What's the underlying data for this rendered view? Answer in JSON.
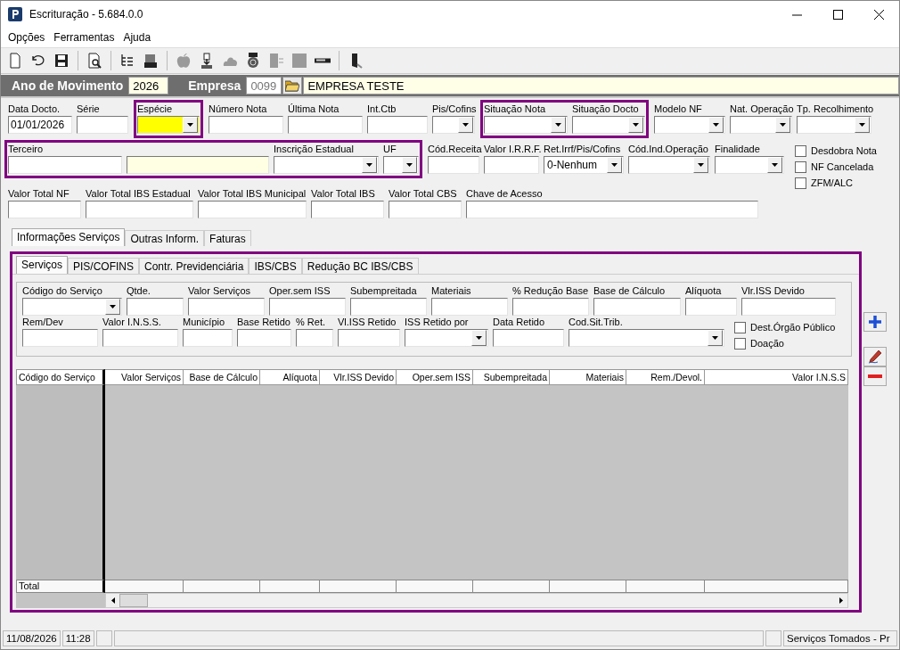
{
  "window": {
    "title": "Escrituração - 5.684.0.0"
  },
  "menu": [
    "Opções",
    "Ferramentas",
    "Ajuda"
  ],
  "toolbar": [
    {
      "kind": "new",
      "disabled": false
    },
    {
      "kind": "undo",
      "disabled": false
    },
    {
      "kind": "save",
      "disabled": false
    },
    {
      "kind": "separator"
    },
    {
      "kind": "preview",
      "disabled": false
    },
    {
      "kind": "separator"
    },
    {
      "kind": "tree",
      "disabled": false
    },
    {
      "kind": "machine",
      "disabled": false
    },
    {
      "kind": "separator"
    },
    {
      "kind": "apple",
      "disabled": true
    },
    {
      "kind": "download",
      "disabled": false
    },
    {
      "kind": "cloud",
      "disabled": true
    },
    {
      "kind": "coin",
      "disabled": false
    },
    {
      "kind": "panel",
      "disabled": true
    },
    {
      "kind": "block",
      "disabled": true
    },
    {
      "kind": "bar",
      "disabled": false
    },
    {
      "kind": "separator"
    },
    {
      "kind": "exit",
      "disabled": false
    }
  ],
  "header": {
    "year_label": "Ano de Movimento",
    "year": "2026",
    "company_label": "Empresa",
    "company_code": "0099",
    "company_name": "EMPRESA TESTE"
  },
  "form_rows": [
    [
      {
        "highlighted": false,
        "fields": [
          {
            "label": "Data Docto.",
            "kind": "text",
            "value": "01/01/2026"
          },
          {
            "label": "Série",
            "kind": "text"
          }
        ]
      },
      {
        "highlighted": true,
        "fields": [
          {
            "label": "Espécie",
            "kind": "combo",
            "focused": true
          }
        ]
      },
      {
        "highlighted": false,
        "fields": [
          {
            "label": "Número Nota",
            "kind": "text"
          },
          {
            "label": "Última Nota",
            "kind": "text"
          },
          {
            "label": "Int.Ctb",
            "kind": "text"
          },
          {
            "label": "Pis/Cofins",
            "kind": "combo"
          }
        ]
      },
      {
        "highlighted": true,
        "fields": [
          {
            "label": "Situação Nota",
            "kind": "combo"
          },
          {
            "label": "Situação Docto",
            "kind": "combo"
          }
        ]
      },
      {
        "highlighted": false,
        "fields": [
          {
            "label": "Modelo NF",
            "kind": "combo"
          },
          {
            "label": "Nat. Operação",
            "kind": "combo"
          },
          {
            "label": "Tp. Recolhimento",
            "kind": "combo"
          }
        ]
      }
    ],
    [
      {
        "highlighted": true,
        "fields": [
          {
            "label": "Terceiro",
            "kind": "text"
          },
          {
            "kind": "display"
          },
          {
            "label": "Inscrição Estadual",
            "kind": "combo"
          },
          {
            "label": "UF",
            "kind": "combo"
          }
        ]
      },
      {
        "highlighted": false,
        "fields": [
          {
            "label": "Cód.Receita",
            "kind": "text"
          },
          {
            "label": "Valor I.R.R.F.",
            "kind": "text"
          },
          {
            "label": "Ret.Irrf/Pis/Cofins",
            "kind": "combo",
            "value": "0-Nenhum"
          },
          {
            "label": "Cód.Ind.Operação",
            "kind": "combo"
          },
          {
            "label": "Finalidade",
            "kind": "combo"
          }
        ]
      }
    ],
    [
      {
        "highlighted": false,
        "fields": [
          {
            "label": "Valor Total NF",
            "kind": "text"
          },
          {
            "label": "Valor Total IBS Estadual",
            "kind": "text"
          },
          {
            "label": "Valor Total IBS Municipal",
            "kind": "text"
          },
          {
            "label": "Valor Total IBS",
            "kind": "text"
          },
          {
            "label": "Valor Total CBS",
            "kind": "text"
          },
          {
            "label": "Chave de Acesso",
            "kind": "text"
          }
        ]
      }
    ]
  ],
  "flags": [
    {
      "label": "Desdobra Nota",
      "checked": false
    },
    {
      "label": "NF Cancelada",
      "checked": false
    },
    {
      "label": "ZFM/ALC",
      "checked": false
    }
  ],
  "tabs": [
    {
      "label": "Informações Serviços",
      "selected": true
    },
    {
      "label": "Outras Inform.",
      "selected": false
    },
    {
      "label": "Faturas",
      "selected": false
    }
  ],
  "subtabs": [
    {
      "label": "Serviços",
      "selected": true
    },
    {
      "label": "PIS/COFINS",
      "selected": false
    },
    {
      "label": "Contr. Previdenciária",
      "selected": false
    },
    {
      "label": "IBS/CBS",
      "selected": false
    },
    {
      "label": "Redução BC IBS/CBS",
      "selected": false
    }
  ],
  "service_rows": [
    [
      {
        "label": "Código do Serviço",
        "kind": "combo"
      },
      {
        "label": "Qtde.",
        "kind": "text"
      },
      {
        "label": "Valor Serviços",
        "kind": "text"
      },
      {
        "label": "Oper.sem ISS",
        "kind": "text"
      },
      {
        "label": "Subempreitada",
        "kind": "text"
      },
      {
        "label": "Materiais",
        "kind": "text"
      },
      {
        "label": "% Redução Base",
        "kind": "text"
      },
      {
        "label": "Base de Cálculo",
        "kind": "text"
      },
      {
        "label": "Alíquota",
        "kind": "text"
      },
      {
        "label": "Vlr.ISS Devido",
        "kind": "text"
      }
    ],
    [
      {
        "label": "Rem/Dev",
        "kind": "text"
      },
      {
        "label": "Valor I.N.S.S.",
        "kind": "text"
      },
      {
        "label": "Município",
        "kind": "text"
      },
      {
        "label": "Base Retido",
        "kind": "text"
      },
      {
        "label": "% Ret.",
        "kind": "text"
      },
      {
        "label": "Vl.ISS Retido",
        "kind": "text"
      },
      {
        "label": "ISS Retido por",
        "kind": "combo"
      },
      {
        "label": "Data Retido",
        "kind": "text"
      },
      {
        "label": "Cod.Sit.Trib.",
        "kind": "combo"
      }
    ]
  ],
  "service_flags": [
    {
      "label": "Dest.Órgão Público",
      "checked": false
    },
    {
      "label": "Doação",
      "checked": false
    }
  ],
  "grid": {
    "columns": [
      "Código do Serviço",
      "Valor Serviços",
      "Base de Cálculo",
      "Alíquota",
      "Vlr.ISS Devido",
      "Oper.sem ISS",
      "Subempreitada",
      "Materiais",
      "Rem./Devol.",
      "Valor I.N.S.S"
    ],
    "total_label": "Total"
  },
  "side_buttons": [
    {
      "kind": "add"
    },
    {
      "kind": "edit"
    },
    {
      "kind": "remove"
    }
  ],
  "status_bar": {
    "date": "11/08/2026",
    "time": "11:28",
    "module": "Serviços Tomados - Pr"
  }
}
